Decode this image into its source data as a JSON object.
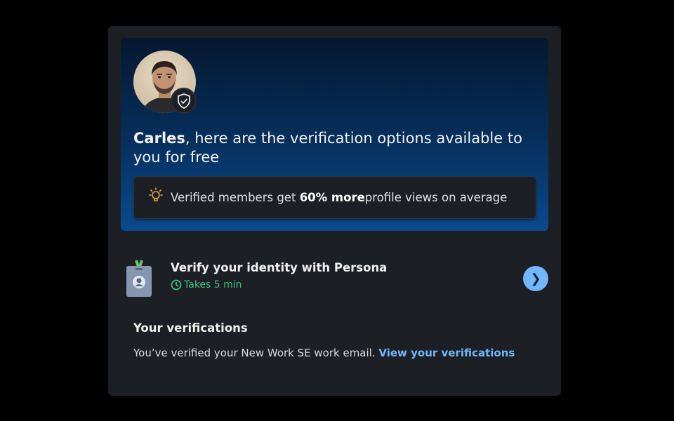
{
  "hero": {
    "name": "Carles",
    "headline_rest": ", here are the verification options available to you for free",
    "tip_prefix": "Verified members get ",
    "tip_bold": "60% more",
    "tip_suffix": " profile views on average"
  },
  "persona": {
    "title": "Verify your identity with Persona",
    "time": "Takes 5 min"
  },
  "verifications": {
    "title": "Your verifications",
    "text": "You’ve verified your New Work SE work email. ",
    "link": "View your verifications"
  },
  "colors": {
    "accent": "#71b7fb",
    "success": "#3fbf7a",
    "bulb": "#e8a33a",
    "card": "#1c2025"
  },
  "icons": [
    "shield-check-icon",
    "lightbulb-icon",
    "id-badge-icon",
    "clock-icon",
    "chevron-right-icon"
  ]
}
